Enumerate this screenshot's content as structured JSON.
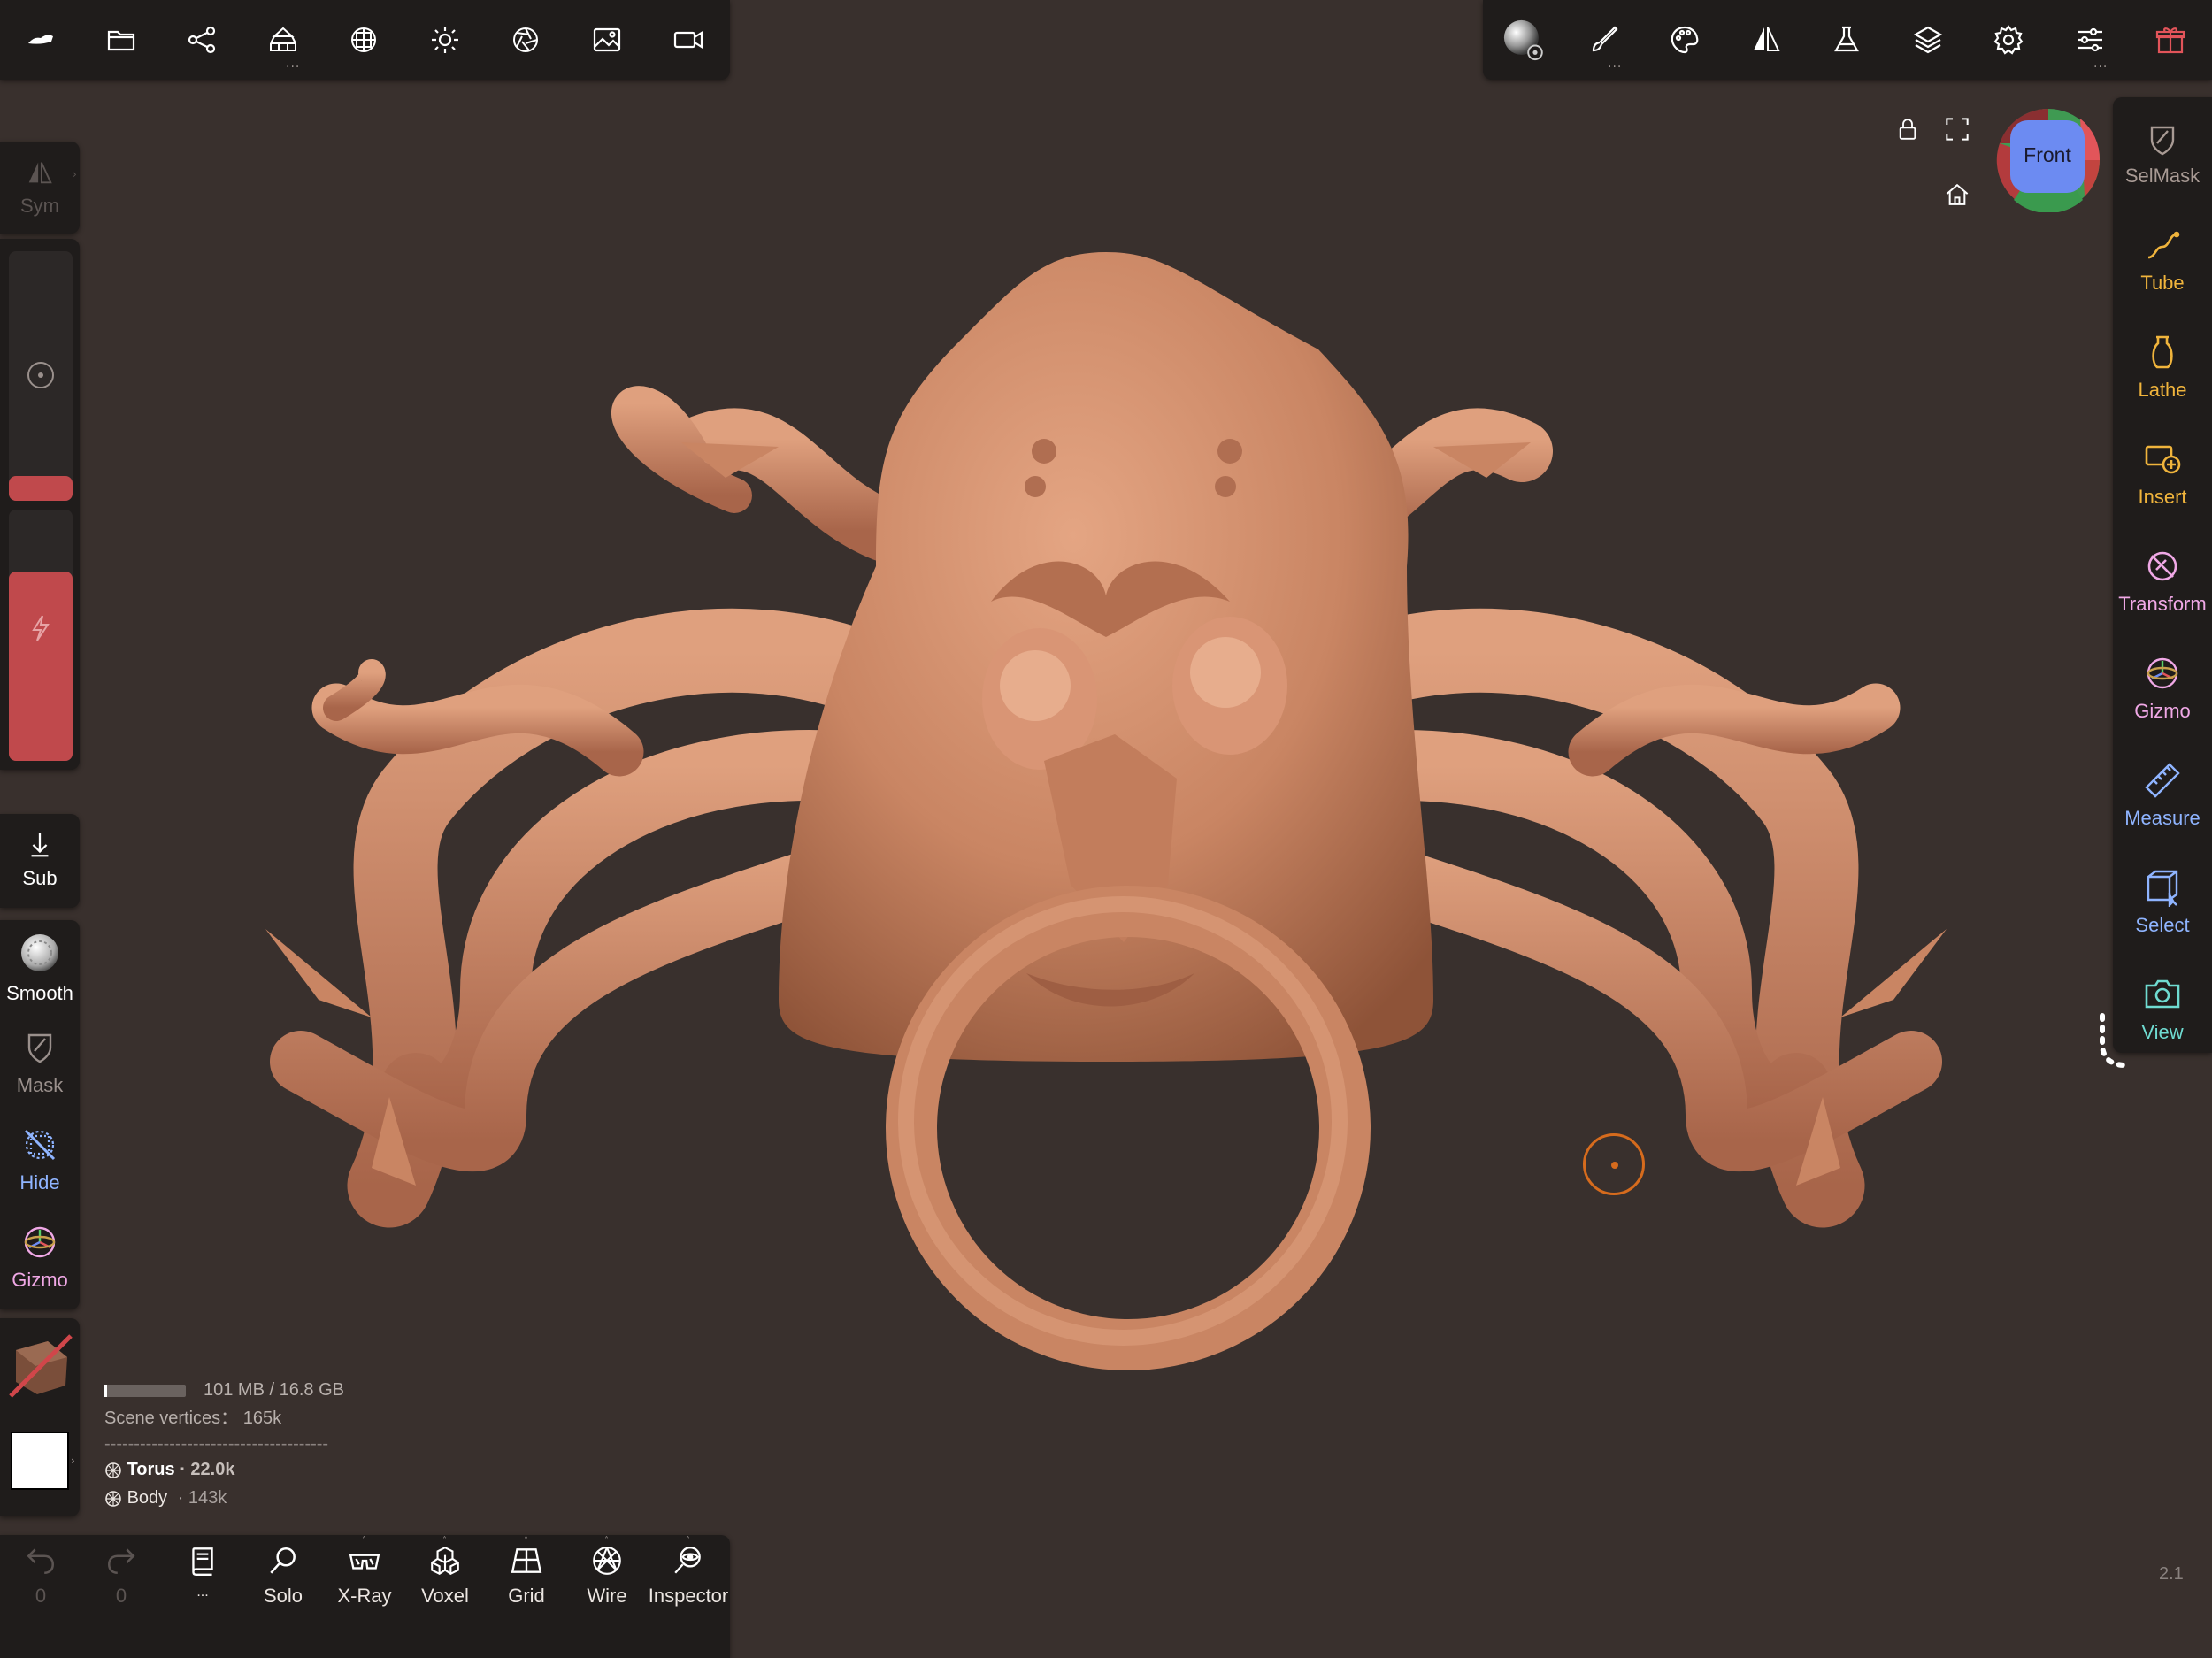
{
  "top_toolbar": {
    "left_icons": [
      "app-menu-icon",
      "folder-icon",
      "scene-graph-icon",
      "topology-icon",
      "mesh-sphere-icon",
      "sun-icon",
      "aperture-icon",
      "image-icon",
      "video-camera-icon"
    ],
    "right_icons": [
      "material-sphere-icon",
      "paint-brush-icon",
      "palette-icon",
      "symmetry-icon",
      "flask-icon",
      "layers-icon",
      "settings-gear-icon",
      "sliders-icon",
      "gift-icon"
    ]
  },
  "viewport": {
    "view_cube_label": "Front",
    "version": "2.1",
    "model_color": "#c98563"
  },
  "left_panel": {
    "sym_label": "Sym",
    "sub_label": "Sub",
    "tools": [
      {
        "label": "Smooth",
        "color": "#ffffff"
      },
      {
        "label": "Mask",
        "color": "#9a908c"
      },
      {
        "label": "Hide",
        "color": "#8fb4ff"
      },
      {
        "label": "Gizmo",
        "color": "#f0a8e6"
      }
    ],
    "radius_accent": "#c0494c",
    "intensity_accent": "#c0494c"
  },
  "right_panel": {
    "tools": [
      {
        "label": "SelMask",
        "icon": "selmask-icon",
        "color": "#a89a94"
      },
      {
        "label": "Tube",
        "icon": "tube-icon",
        "color": "#f0b43c"
      },
      {
        "label": "Lathe",
        "icon": "lathe-icon",
        "color": "#f0b43c"
      },
      {
        "label": "Insert",
        "icon": "insert-icon",
        "color": "#f0b43c"
      },
      {
        "label": "Transform",
        "icon": "transform-icon",
        "color": "#f0a8e6"
      },
      {
        "label": "Gizmo",
        "icon": "gizmo-icon",
        "color": "#f0a8e6"
      },
      {
        "label": "Measure",
        "icon": "ruler-icon",
        "color": "#8fb4ff"
      },
      {
        "label": "Select",
        "icon": "select-icon",
        "color": "#8fb4ff"
      },
      {
        "label": "View",
        "icon": "camera-icon",
        "color": "#6fdbd1"
      }
    ]
  },
  "stats": {
    "memory": "101 MB / 16.8 GB",
    "memory_fraction": 0.006,
    "scene_vertices": "Scene vertices： 165k",
    "divider": "--------------------------------------",
    "objects": [
      {
        "name": "Torus",
        "count": "· 22.0k",
        "bold": true
      },
      {
        "name": "Body",
        "count": "· 143k",
        "bold": false
      }
    ]
  },
  "bottom_toolbar": {
    "undo_count": "0",
    "redo_count": "0",
    "dots": "...",
    "items": [
      "Solo",
      "X-Ray",
      "Voxel",
      "Grid",
      "Wire",
      "Inspector"
    ]
  }
}
